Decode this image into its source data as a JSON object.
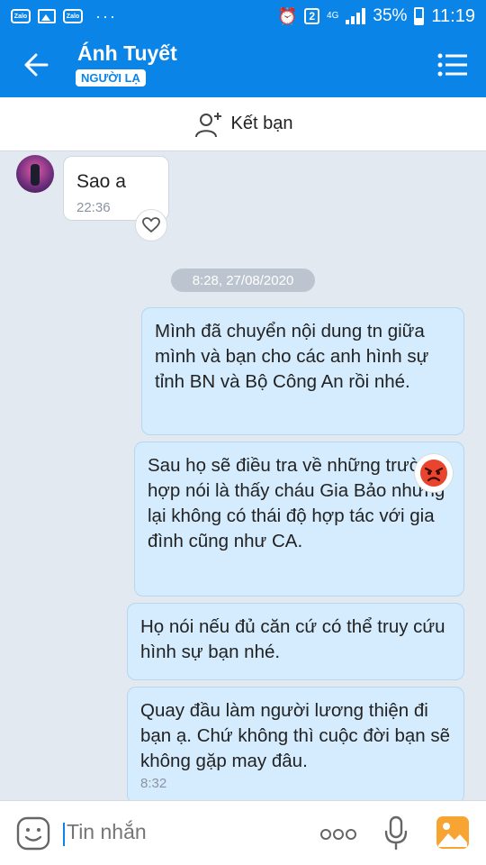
{
  "status_bar": {
    "notif_label": "Zalo",
    "dots": "···",
    "sim_badge": "2",
    "network": "4G",
    "battery": "35%",
    "time": "11:19"
  },
  "header": {
    "title": "Ánh Tuyết",
    "badge": "NGƯỜI LẠ",
    "accent_color": "#0b84e8"
  },
  "add_friend": {
    "label": "Kết bạn"
  },
  "chat": {
    "incoming": {
      "text": "Sao a",
      "time": "22:36"
    },
    "date_chip": "8:28, 27/08/2020",
    "outgoing": [
      {
        "text": "Mình đã chuyển nội dung tn giữa mình và bạn cho các anh hình sự tỉnh BN và Bộ Công An rồi nhé."
      },
      {
        "text": "Sau họ sẽ điều tra về những trường hợp nói là thấy cháu Gia Bảo nhưng lại không có thái độ hợp tác với gia đình cũng như CA."
      },
      {
        "text": "Họ nói nếu đủ căn cứ có thể truy cứu hình sự bạn nhé."
      },
      {
        "text": "Quay đầu làm người lương thiện đi bạn ạ. Chứ không thì cuộc đời bạn sẽ không gặp may đâu.",
        "time": "8:32"
      }
    ]
  },
  "input_bar": {
    "placeholder": "Tin nhắn",
    "more_glyph": "ooo"
  }
}
